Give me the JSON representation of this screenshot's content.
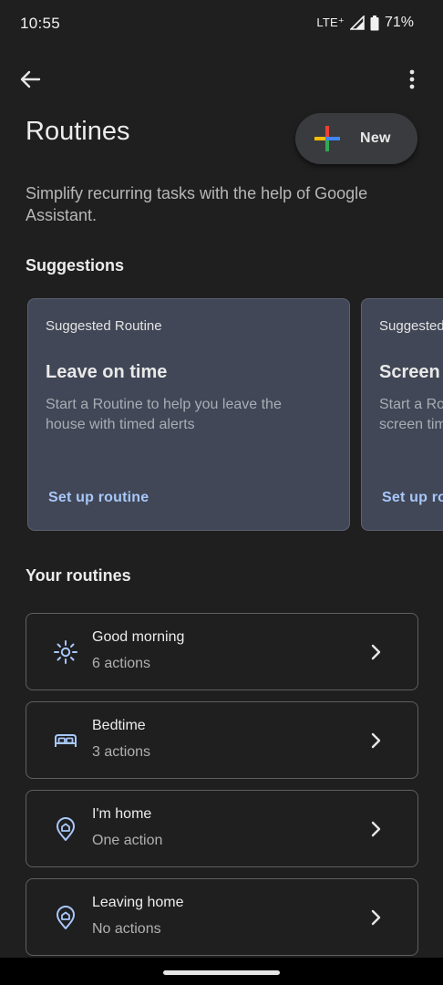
{
  "status_bar": {
    "time": "10:55",
    "network": "LTE⁺",
    "battery": "71%"
  },
  "app_bar": {
    "back_icon": "arrow-back-icon",
    "menu_icon": "more-vert-icon"
  },
  "header": {
    "title": "Routines",
    "new_button_label": "New",
    "subtitle": "Simplify recurring tasks with the help of Google Assistant."
  },
  "suggestions": {
    "title": "Suggestions",
    "cards": [
      {
        "eyebrow": "Suggested Routine",
        "title": "Leave on time",
        "description": "Start a Routine to help you leave the house with timed alerts",
        "action": "Set up routine"
      },
      {
        "eyebrow": "Suggested Routine",
        "title": "Screen time",
        "description": "Start a Routine to help manage",
        "description2": "screen time",
        "action": "Set up routine"
      }
    ]
  },
  "your_routines": {
    "title": "Your routines",
    "items": [
      {
        "name": "Good morning",
        "count": "6 actions",
        "icon": "sun-icon"
      },
      {
        "name": "Bedtime",
        "count": "3 actions",
        "icon": "bed-icon"
      },
      {
        "name": "I'm home",
        "count": "One action",
        "icon": "home-location-icon"
      },
      {
        "name": "Leaving home",
        "count": "No actions",
        "icon": "home-location-icon"
      }
    ]
  },
  "colors": {
    "background": "#1f1f1f",
    "accent": "#a8c7fa",
    "card_bg": "#414756"
  }
}
